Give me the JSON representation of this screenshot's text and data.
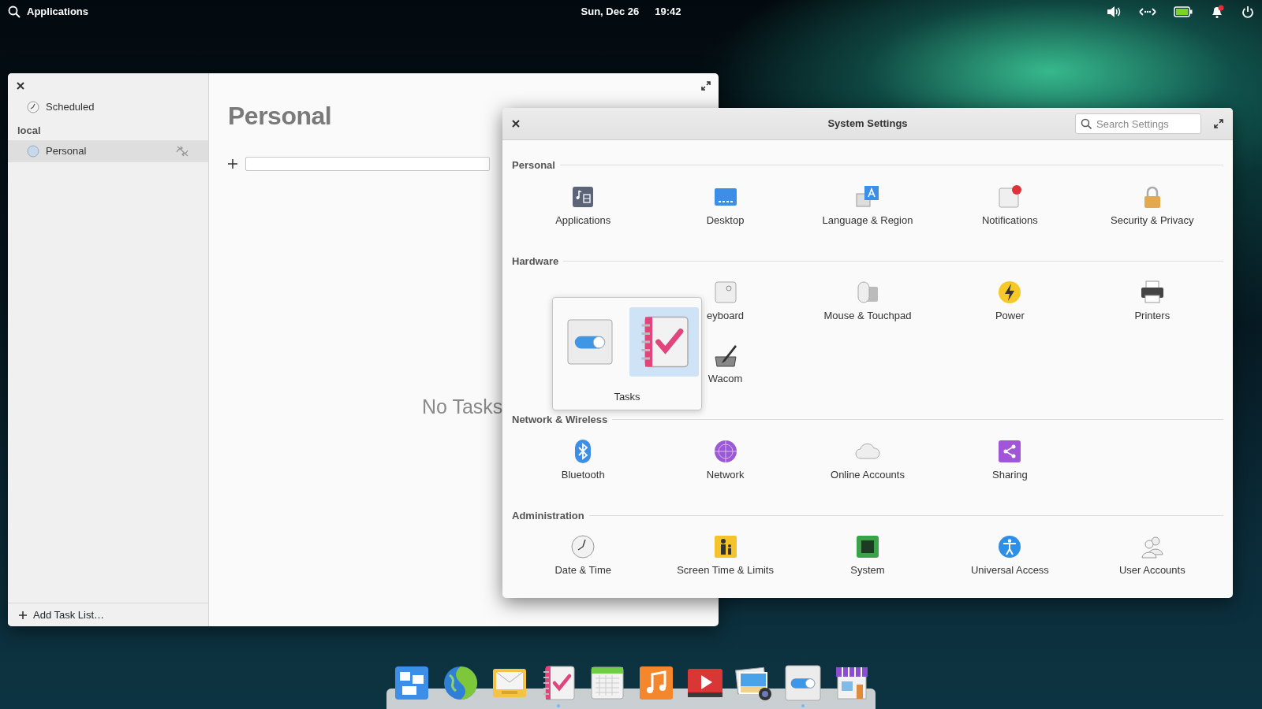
{
  "top_bar": {
    "applications": "Applications",
    "date": "Sun, Dec 26",
    "time": "19:42",
    "notifications_unread": true
  },
  "tasks_window": {
    "sidebar": {
      "items": [
        {
          "label": "Scheduled",
          "selected": false
        }
      ],
      "groups": [
        {
          "title": "local",
          "items": [
            {
              "label": "Personal",
              "selected": true
            }
          ]
        }
      ],
      "footer": "Add Task List…"
    },
    "title": "Personal",
    "empty_text": "No Tasks"
  },
  "settings_window": {
    "title": "System Settings",
    "search": {
      "placeholder": "Search Settings"
    },
    "sections": [
      {
        "title": "Personal",
        "items": [
          {
            "kind": "applications",
            "label": "Applications"
          },
          {
            "kind": "desktop",
            "label": "Desktop"
          },
          {
            "kind": "language",
            "label": "Language & Region"
          },
          {
            "kind": "notifications",
            "label": "Notifications"
          },
          {
            "kind": "security",
            "label": "Security & Privacy"
          }
        ]
      },
      {
        "title": "Hardware",
        "items": [
          {
            "kind": "covered"
          },
          {
            "kind": "keyboard",
            "label": "eyboard"
          },
          {
            "kind": "mouse",
            "label": "Mouse & Touchpad"
          },
          {
            "kind": "power",
            "label": "Power"
          },
          {
            "kind": "printers",
            "label": "Printers"
          },
          {
            "kind": "covered"
          },
          {
            "kind": "wacom",
            "label": "Wacom"
          }
        ]
      },
      {
        "title": "Network & Wireless",
        "items": [
          {
            "kind": "bluetooth",
            "label": "Bluetooth"
          },
          {
            "kind": "network",
            "label": "Network"
          },
          {
            "kind": "online",
            "label": "Online Accounts"
          },
          {
            "kind": "sharing",
            "label": "Sharing"
          }
        ]
      },
      {
        "title": "Administration",
        "items": [
          {
            "kind": "datetime",
            "label": "Date & Time"
          },
          {
            "kind": "screentime",
            "label": "Screen Time & Limits"
          },
          {
            "kind": "system",
            "label": "System"
          },
          {
            "kind": "universal",
            "label": "Universal Access"
          },
          {
            "kind": "users",
            "label": "User Accounts"
          }
        ]
      }
    ]
  },
  "switcher": {
    "items": [
      {
        "kind": "toggle",
        "selected": false
      },
      {
        "kind": "tasks",
        "selected": true
      }
    ],
    "label": "Tasks"
  },
  "dock": [
    {
      "kind": "multitasking",
      "running": false
    },
    {
      "kind": "browser",
      "running": false
    },
    {
      "kind": "mail",
      "running": false
    },
    {
      "kind": "tasks",
      "running": true
    },
    {
      "kind": "calendar",
      "running": false
    },
    {
      "kind": "music",
      "running": false
    },
    {
      "kind": "video",
      "running": false
    },
    {
      "kind": "photos",
      "running": false
    },
    {
      "kind": "toggle",
      "running": true
    },
    {
      "kind": "store",
      "running": false
    }
  ]
}
